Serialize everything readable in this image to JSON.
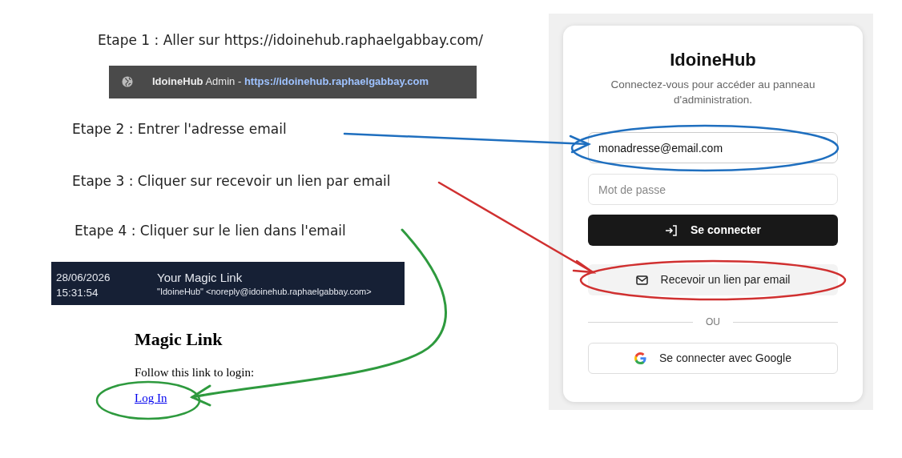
{
  "steps": [
    {
      "text": "Etape 1 : Aller sur https://idoinehub.raphaelgabbay.com/"
    },
    {
      "text": "Etape 2 : Entrer l'adresse email"
    },
    {
      "text": "Etape 3 : Cliquer sur recevoir un lien par email"
    },
    {
      "text": "Etape 4 : Cliquer sur le lien dans l'email"
    }
  ],
  "browser_tab": {
    "site": "IdoineHub",
    "title": "Admin",
    "separator": "-",
    "url": "https://idoinehub.raphaelgabbay.com"
  },
  "email": {
    "date": "28/06/2026",
    "time": "15:31:54",
    "subject": "Your Magic Link",
    "sender": "\"IdoineHub\" <noreply@idoinehub.raphaelgabbay.com>",
    "heading": "Magic Link",
    "body": "Follow this link to login:",
    "link": "Log In"
  },
  "login": {
    "title": "IdoineHub",
    "subtitle": "Connectez-vous pour accéder au panneau d'administration.",
    "email_field": {
      "value": "monadresse@email.com"
    },
    "password_field": {
      "placeholder": "Mot de passe"
    },
    "buttons": [
      {
        "label": "Se connecter",
        "kind": "primary"
      },
      {
        "label": "Recevoir un lien par email",
        "kind": "secondary"
      }
    ],
    "divider": "OU",
    "google_button": {
      "label": "Se connecter avec Google"
    }
  },
  "annotations": [
    {
      "kind": "straight",
      "color": "#1f6fbf"
    },
    {
      "kind": "straight",
      "color": "#d03030"
    },
    {
      "kind": "curved",
      "color": "#2e9a3e"
    }
  ]
}
